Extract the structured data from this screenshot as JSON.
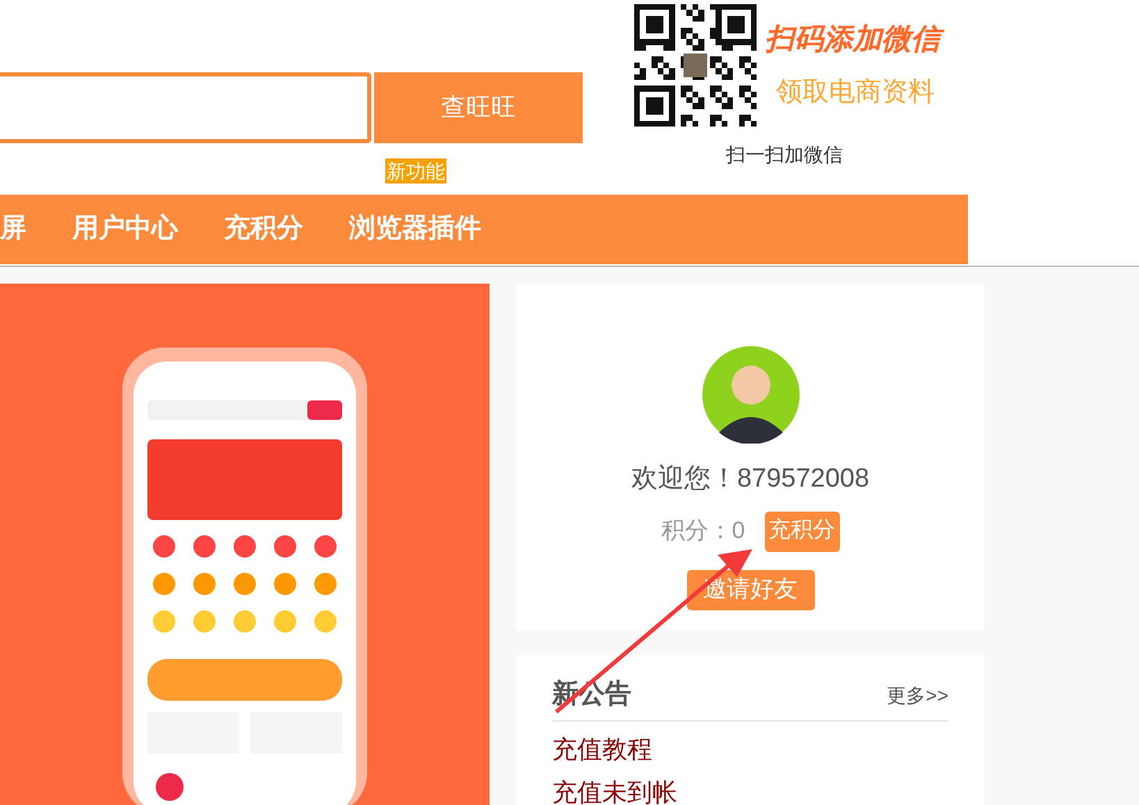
{
  "search": {
    "button": "查旺旺",
    "badge": "新功能"
  },
  "wechat_promo": {
    "headline": "扫码添加微信",
    "subline": "领取电商资料",
    "caption": "扫一扫加微信"
  },
  "nav": [
    {
      "label": "屏"
    },
    {
      "label": "用户中心"
    },
    {
      "label": "充积分"
    },
    {
      "label": "浏览器插件"
    }
  ],
  "profile": {
    "greeting": "欢迎您！879572008",
    "points_label": "积分：",
    "points": "0",
    "recharge_button": "充积分",
    "invite_button": "邀请好友"
  },
  "notices": {
    "title": "新公告",
    "more": "更多>>",
    "items": [
      "充值教程",
      "充值未到帐"
    ]
  }
}
